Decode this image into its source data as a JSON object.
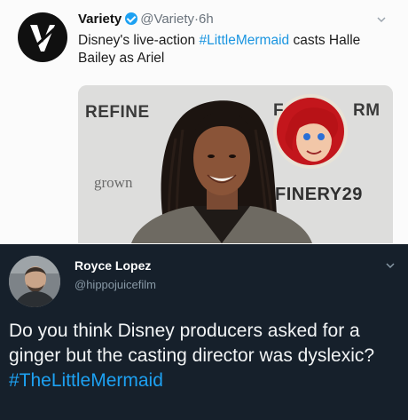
{
  "top_tweet": {
    "author_name": "Variety",
    "handle": "@Variety",
    "separator": "·",
    "time": "6h",
    "avatar_icon": "variety-v-logo-icon",
    "verified_icon": "verified-badge-icon",
    "text_before": "Disney's live-action ",
    "hashtag": "#LittleMermaid",
    "text_after": " casts Halle Bailey as Ariel",
    "photo": {
      "logo_left": "REFINE",
      "logo_right_top": "RM",
      "logo_right_top_prefix": "F",
      "logo_right_bottom": "FINERY29",
      "logo_grown": "grown"
    }
  },
  "reply_tweet": {
    "author_name": "Royce Lopez",
    "handle": "@hippojuicefilm",
    "text": "Do you think Disney producers asked for a ginger but the casting director was dyslexic? ",
    "hashtag": "#TheLittleMermaid"
  },
  "colors": {
    "dark_background": "#16202b",
    "hashtag_blue": "#1da1f2",
    "light_background": "#fbfbfb"
  }
}
